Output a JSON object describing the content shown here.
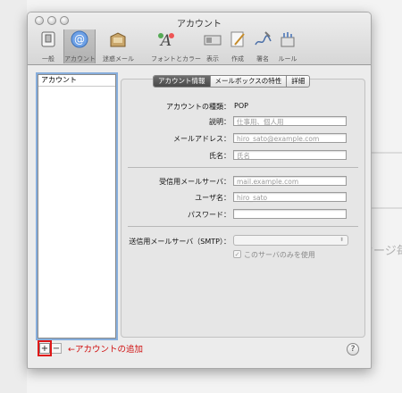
{
  "background": {
    "partial_text": "セージ毎"
  },
  "window": {
    "title": "アカウント"
  },
  "toolbar": {
    "items": [
      {
        "label": "一般",
        "icon": "general-switch-icon"
      },
      {
        "label": "アカウント",
        "icon": "at-sign-icon"
      },
      {
        "label": "迷惑メール",
        "icon": "junk-mail-icon"
      },
      {
        "label": "フォントとカラー",
        "icon": "fonts-colors-icon"
      },
      {
        "label": "表示",
        "icon": "display-icon"
      },
      {
        "label": "作成",
        "icon": "compose-icon"
      },
      {
        "label": "署名",
        "icon": "signature-icon"
      },
      {
        "label": "ルール",
        "icon": "rules-icon"
      }
    ]
  },
  "accounts_list": {
    "header": "アカウント"
  },
  "tabs": [
    "アカウント情報",
    "メールボックスの特性",
    "詳細"
  ],
  "form": {
    "account_type_label": "アカウントの種類：",
    "account_type_value": "POP",
    "description_label": "説明：",
    "description_placeholder": "仕事用、個人用",
    "email_label": "メールアドレス：",
    "email_placeholder": "hiro_sato@example.com",
    "fullname_label": "氏名：",
    "fullname_placeholder": "氏名",
    "incoming_server_label": "受信用メールサーバ：",
    "incoming_server_placeholder": "mail.example.com",
    "username_label": "ユーザ名：",
    "username_placeholder": "hiro_sato",
    "password_label": "パスワード：",
    "password_value": "",
    "smtp_label": "送信用メールサーバ（SMTP）：",
    "smtp_value": "",
    "smtp_only_label": "このサーバのみを使用",
    "smtp_only_checked": true
  },
  "footer": {
    "add_symbol": "+",
    "remove_symbol": "−",
    "annotation": "←アカウントの追加",
    "help_symbol": "?"
  },
  "colors": {
    "annotation": "#d01010",
    "list_focus": "#87aedc"
  }
}
